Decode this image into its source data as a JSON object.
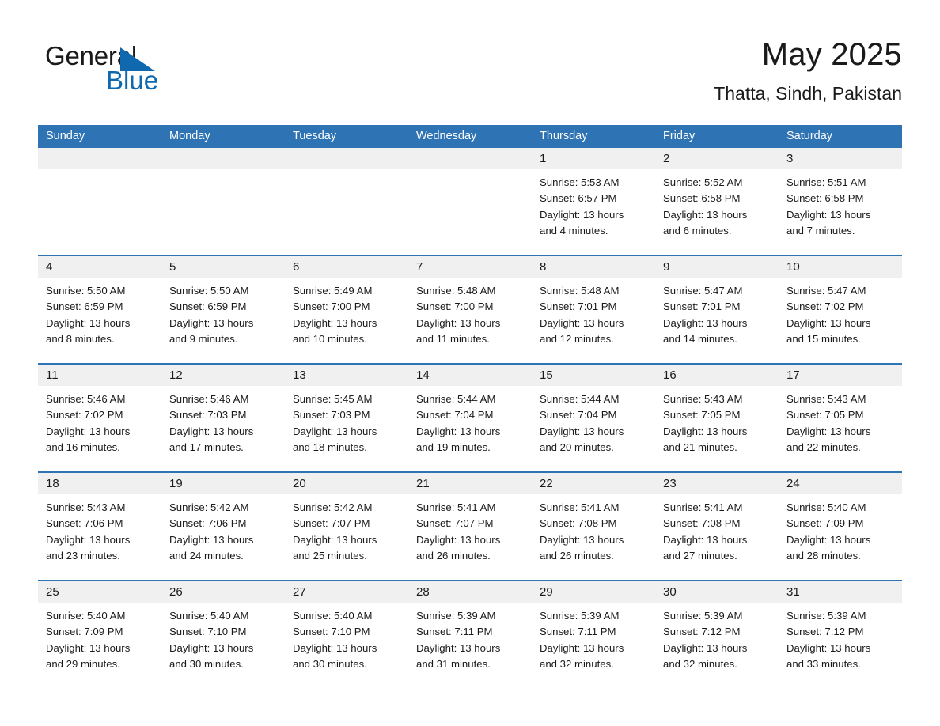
{
  "brand": {
    "line1": "General",
    "line2": "Blue",
    "triangle_icon": "blue-triangle-logo-mark",
    "colors": {
      "text": "#1a1a1a",
      "blue": "#1068ae"
    }
  },
  "header": {
    "title": "May 2025",
    "subtitle": "Thatta, Sindh, Pakistan"
  },
  "theme": {
    "header_blue": "#2e74b5",
    "number_band": "#f0f0f0",
    "cell_bg": "#ffffff",
    "text": "#1a1a1a"
  },
  "calendar": {
    "weekdays": [
      "Sunday",
      "Monday",
      "Tuesday",
      "Wednesday",
      "Thursday",
      "Friday",
      "Saturday"
    ],
    "weeks": [
      {
        "days": [
          {
            "num": "",
            "lines": []
          },
          {
            "num": "",
            "lines": []
          },
          {
            "num": "",
            "lines": []
          },
          {
            "num": "",
            "lines": []
          },
          {
            "num": "1",
            "lines": [
              "Sunrise: 5:53 AM",
              "Sunset: 6:57 PM",
              "Daylight: 13 hours",
              "and 4 minutes."
            ]
          },
          {
            "num": "2",
            "lines": [
              "Sunrise: 5:52 AM",
              "Sunset: 6:58 PM",
              "Daylight: 13 hours",
              "and 6 minutes."
            ]
          },
          {
            "num": "3",
            "lines": [
              "Sunrise: 5:51 AM",
              "Sunset: 6:58 PM",
              "Daylight: 13 hours",
              "and 7 minutes."
            ]
          }
        ]
      },
      {
        "days": [
          {
            "num": "4",
            "lines": [
              "Sunrise: 5:50 AM",
              "Sunset: 6:59 PM",
              "Daylight: 13 hours",
              "and 8 minutes."
            ]
          },
          {
            "num": "5",
            "lines": [
              "Sunrise: 5:50 AM",
              "Sunset: 6:59 PM",
              "Daylight: 13 hours",
              "and 9 minutes."
            ]
          },
          {
            "num": "6",
            "lines": [
              "Sunrise: 5:49 AM",
              "Sunset: 7:00 PM",
              "Daylight: 13 hours",
              "and 10 minutes."
            ]
          },
          {
            "num": "7",
            "lines": [
              "Sunrise: 5:48 AM",
              "Sunset: 7:00 PM",
              "Daylight: 13 hours",
              "and 11 minutes."
            ]
          },
          {
            "num": "8",
            "lines": [
              "Sunrise: 5:48 AM",
              "Sunset: 7:01 PM",
              "Daylight: 13 hours",
              "and 12 minutes."
            ]
          },
          {
            "num": "9",
            "lines": [
              "Sunrise: 5:47 AM",
              "Sunset: 7:01 PM",
              "Daylight: 13 hours",
              "and 14 minutes."
            ]
          },
          {
            "num": "10",
            "lines": [
              "Sunrise: 5:47 AM",
              "Sunset: 7:02 PM",
              "Daylight: 13 hours",
              "and 15 minutes."
            ]
          }
        ]
      },
      {
        "days": [
          {
            "num": "11",
            "lines": [
              "Sunrise: 5:46 AM",
              "Sunset: 7:02 PM",
              "Daylight: 13 hours",
              "and 16 minutes."
            ]
          },
          {
            "num": "12",
            "lines": [
              "Sunrise: 5:46 AM",
              "Sunset: 7:03 PM",
              "Daylight: 13 hours",
              "and 17 minutes."
            ]
          },
          {
            "num": "13",
            "lines": [
              "Sunrise: 5:45 AM",
              "Sunset: 7:03 PM",
              "Daylight: 13 hours",
              "and 18 minutes."
            ]
          },
          {
            "num": "14",
            "lines": [
              "Sunrise: 5:44 AM",
              "Sunset: 7:04 PM",
              "Daylight: 13 hours",
              "and 19 minutes."
            ]
          },
          {
            "num": "15",
            "lines": [
              "Sunrise: 5:44 AM",
              "Sunset: 7:04 PM",
              "Daylight: 13 hours",
              "and 20 minutes."
            ]
          },
          {
            "num": "16",
            "lines": [
              "Sunrise: 5:43 AM",
              "Sunset: 7:05 PM",
              "Daylight: 13 hours",
              "and 21 minutes."
            ]
          },
          {
            "num": "17",
            "lines": [
              "Sunrise: 5:43 AM",
              "Sunset: 7:05 PM",
              "Daylight: 13 hours",
              "and 22 minutes."
            ]
          }
        ]
      },
      {
        "days": [
          {
            "num": "18",
            "lines": [
              "Sunrise: 5:43 AM",
              "Sunset: 7:06 PM",
              "Daylight: 13 hours",
              "and 23 minutes."
            ]
          },
          {
            "num": "19",
            "lines": [
              "Sunrise: 5:42 AM",
              "Sunset: 7:06 PM",
              "Daylight: 13 hours",
              "and 24 minutes."
            ]
          },
          {
            "num": "20",
            "lines": [
              "Sunrise: 5:42 AM",
              "Sunset: 7:07 PM",
              "Daylight: 13 hours",
              "and 25 minutes."
            ]
          },
          {
            "num": "21",
            "lines": [
              "Sunrise: 5:41 AM",
              "Sunset: 7:07 PM",
              "Daylight: 13 hours",
              "and 26 minutes."
            ]
          },
          {
            "num": "22",
            "lines": [
              "Sunrise: 5:41 AM",
              "Sunset: 7:08 PM",
              "Daylight: 13 hours",
              "and 26 minutes."
            ]
          },
          {
            "num": "23",
            "lines": [
              "Sunrise: 5:41 AM",
              "Sunset: 7:08 PM",
              "Daylight: 13 hours",
              "and 27 minutes."
            ]
          },
          {
            "num": "24",
            "lines": [
              "Sunrise: 5:40 AM",
              "Sunset: 7:09 PM",
              "Daylight: 13 hours",
              "and 28 minutes."
            ]
          }
        ]
      },
      {
        "days": [
          {
            "num": "25",
            "lines": [
              "Sunrise: 5:40 AM",
              "Sunset: 7:09 PM",
              "Daylight: 13 hours",
              "and 29 minutes."
            ]
          },
          {
            "num": "26",
            "lines": [
              "Sunrise: 5:40 AM",
              "Sunset: 7:10 PM",
              "Daylight: 13 hours",
              "and 30 minutes."
            ]
          },
          {
            "num": "27",
            "lines": [
              "Sunrise: 5:40 AM",
              "Sunset: 7:10 PM",
              "Daylight: 13 hours",
              "and 30 minutes."
            ]
          },
          {
            "num": "28",
            "lines": [
              "Sunrise: 5:39 AM",
              "Sunset: 7:11 PM",
              "Daylight: 13 hours",
              "and 31 minutes."
            ]
          },
          {
            "num": "29",
            "lines": [
              "Sunrise: 5:39 AM",
              "Sunset: 7:11 PM",
              "Daylight: 13 hours",
              "and 32 minutes."
            ]
          },
          {
            "num": "30",
            "lines": [
              "Sunrise: 5:39 AM",
              "Sunset: 7:12 PM",
              "Daylight: 13 hours",
              "and 32 minutes."
            ]
          },
          {
            "num": "31",
            "lines": [
              "Sunrise: 5:39 AM",
              "Sunset: 7:12 PM",
              "Daylight: 13 hours",
              "and 33 minutes."
            ]
          }
        ]
      }
    ]
  }
}
